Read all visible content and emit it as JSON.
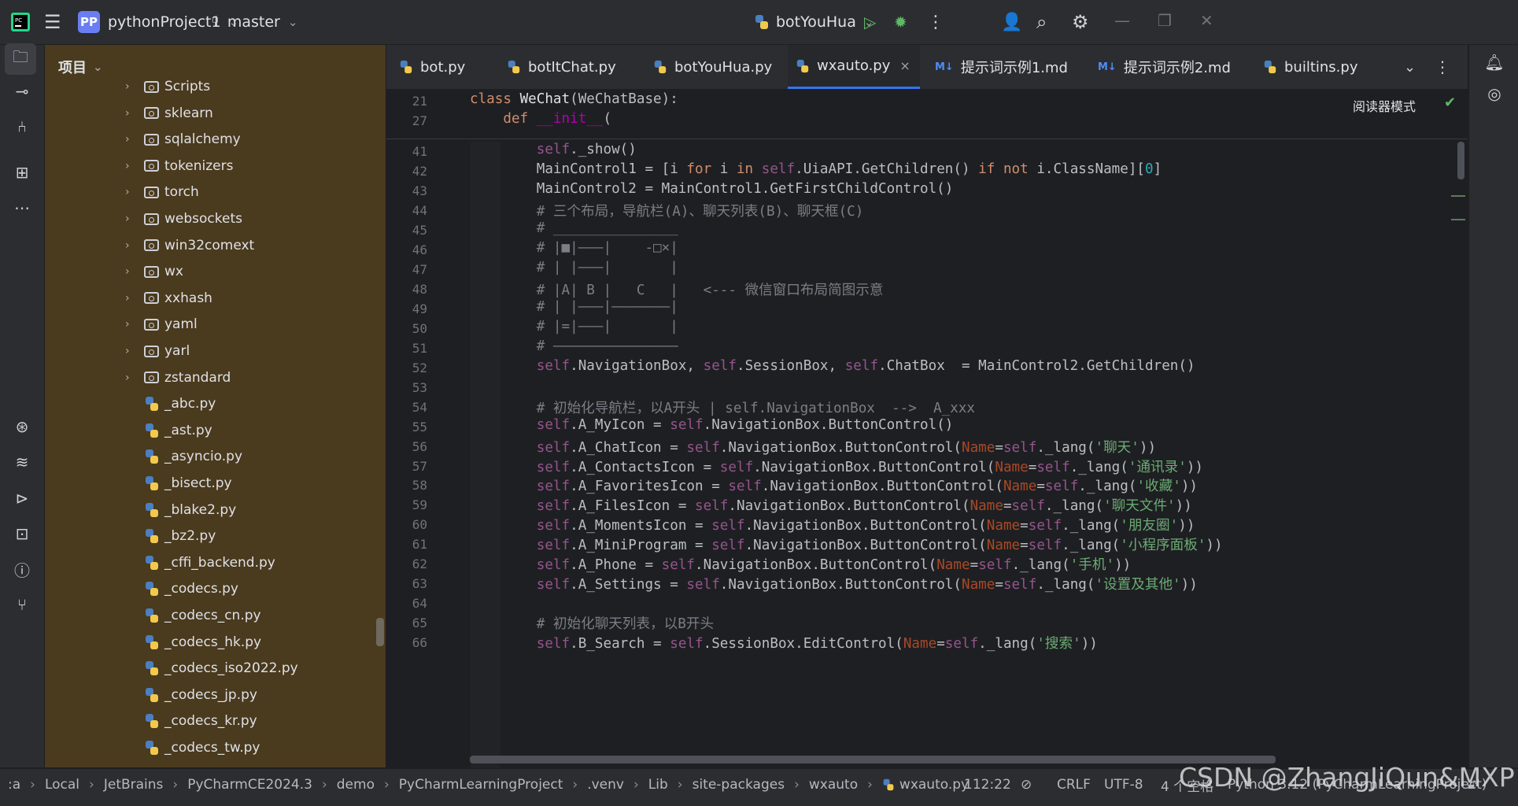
{
  "titlebar": {
    "project_badge": "PP",
    "project_name": "pythonProject1",
    "branch": "master",
    "run_config": "botYouHua"
  },
  "project_panel": {
    "title": "项目",
    "folders": [
      "Scripts",
      "sklearn",
      "sqlalchemy",
      "tokenizers",
      "torch",
      "websockets",
      "win32comext",
      "wx",
      "xxhash",
      "yaml",
      "yarl",
      "zstandard"
    ],
    "files": [
      "_abc.py",
      "_ast.py",
      "_asyncio.py",
      "_bisect.py",
      "_blake2.py",
      "_bz2.py",
      "_cffi_backend.py",
      "_codecs.py",
      "_codecs_cn.py",
      "_codecs_hk.py",
      "_codecs_iso2022.py",
      "_codecs_jp.py",
      "_codecs_kr.py",
      "_codecs_tw.py"
    ]
  },
  "tabs": [
    {
      "label": "bot.py",
      "type": "py"
    },
    {
      "label": "botItChat.py",
      "type": "py"
    },
    {
      "label": "botYouHua.py",
      "type": "py"
    },
    {
      "label": "wxauto.py",
      "type": "py",
      "active": true
    },
    {
      "label": "提示词示例1.md",
      "type": "md"
    },
    {
      "label": "提示词示例2.md",
      "type": "md"
    },
    {
      "label": "builtins.py",
      "type": "py"
    }
  ],
  "editor": {
    "reader_mode": "阅读器模式",
    "md_icon_text": "M↓",
    "sticky_lines": [
      {
        "num": "21",
        "html": "<span class='kw'>class</span> <span class='fn'>WeChat</span>(WeChatBase):"
      },
      {
        "num": "27",
        "html": "    <span class='kw'>def</span> <span class='dn'>__init__</span>("
      }
    ],
    "lines": [
      {
        "num": "41",
        "html": "        <span class='sf'>self</span>._show()"
      },
      {
        "num": "42",
        "html": "        MainControl1 = [i <span class='kw'>for</span> i <span class='kw'>in</span> <span class='sf'>self</span>.UiaAPI.GetChildren() <span class='kw'>if not</span> i.ClassName][<span class='nm'>0</span>]"
      },
      {
        "num": "43",
        "html": "        MainControl2 = MainControl1.GetFirstChildControl()"
      },
      {
        "num": "44",
        "html": "        <span class='cm'># 三个布局，导航栏(A)、聊天列表(B)、聊天框(C)</span>"
      },
      {
        "num": "45",
        "html": "        <span class='cm'># _______________</span>"
      },
      {
        "num": "46",
        "html": "        <span class='cm'># |■|———|    -□×|</span>"
      },
      {
        "num": "47",
        "html": "        <span class='cm'># | |———|       |</span>"
      },
      {
        "num": "48",
        "html": "        <span class='cm'># |A| B |   C   |   &lt;--- 微信窗口布局简图示意</span>"
      },
      {
        "num": "49",
        "html": "        <span class='cm'># | |———|———————|</span>"
      },
      {
        "num": "50",
        "html": "        <span class='cm'># |=|———|       |</span>"
      },
      {
        "num": "51",
        "html": "        <span class='cm'># ———————————————</span>"
      },
      {
        "num": "52",
        "html": "        <span class='sf'>self</span>.NavigationBox, <span class='sf'>self</span>.SessionBox, <span class='sf'>self</span>.ChatBox  = MainControl2.GetChildren()"
      },
      {
        "num": "53",
        "html": ""
      },
      {
        "num": "54",
        "html": "        <span class='cm'># 初始化导航栏，以A开头 | self.NavigationBox  --&gt;  A_xxx</span>"
      },
      {
        "num": "55",
        "html": "        <span class='sf'>self</span>.A_MyIcon = <span class='sf'>self</span>.NavigationBox.ButtonControl()"
      },
      {
        "num": "56",
        "html": "        <span class='sf'>self</span>.A_ChatIcon = <span class='sf'>self</span>.NavigationBox.ButtonControl(<span class='pr'>Name</span>=<span class='sf'>self</span>._lang(<span class='st'>'聊天'</span>))"
      },
      {
        "num": "57",
        "html": "        <span class='sf'>self</span>.A_ContactsIcon = <span class='sf'>self</span>.NavigationBox.ButtonControl(<span class='pr'>Name</span>=<span class='sf'>self</span>._lang(<span class='st'>'通讯录'</span>))"
      },
      {
        "num": "58",
        "html": "        <span class='sf'>self</span>.A_FavoritesIcon = <span class='sf'>self</span>.NavigationBox.ButtonControl(<span class='pr'>Name</span>=<span class='sf'>self</span>._lang(<span class='st'>'收藏'</span>))"
      },
      {
        "num": "59",
        "html": "        <span class='sf'>self</span>.A_FilesIcon = <span class='sf'>self</span>.NavigationBox.ButtonControl(<span class='pr'>Name</span>=<span class='sf'>self</span>._lang(<span class='st'>'聊天文件'</span>))"
      },
      {
        "num": "60",
        "html": "        <span class='sf'>self</span>.A_MomentsIcon = <span class='sf'>self</span>.NavigationBox.ButtonControl(<span class='pr'>Name</span>=<span class='sf'>self</span>._lang(<span class='st'>'朋友圈'</span>))"
      },
      {
        "num": "61",
        "html": "        <span class='sf'>self</span>.A_MiniProgram = <span class='sf'>self</span>.NavigationBox.ButtonControl(<span class='pr'>Name</span>=<span class='sf'>self</span>._lang(<span class='st'>'小程序面板'</span>))"
      },
      {
        "num": "62",
        "html": "        <span class='sf'>self</span>.A_Phone = <span class='sf'>self</span>.NavigationBox.ButtonControl(<span class='pr'>Name</span>=<span class='sf'>self</span>._lang(<span class='st'>'手机'</span>))"
      },
      {
        "num": "63",
        "html": "        <span class='sf'>self</span>.A_Settings = <span class='sf'>self</span>.NavigationBox.ButtonControl(<span class='pr'>Name</span>=<span class='sf'>self</span>._lang(<span class='st'>'设置及其他'</span>))"
      },
      {
        "num": "64",
        "html": ""
      },
      {
        "num": "65",
        "html": "        <span class='cm'># 初始化聊天列表，以B开头</span>"
      },
      {
        "num": "66",
        "html": "        <span class='sf'>self</span>.B_Search = <span class='sf'>self</span>.SessionBox.EditControl(<span class='pr'>Name</span>=<span class='sf'>self</span>._lang(<span class='st'>'搜索'</span>))"
      }
    ]
  },
  "statusbar": {
    "breadcrumbs": [
      ":a",
      "Local",
      "JetBrains",
      "PyCharmCE2024.3",
      "demo",
      "PyCharmLearningProject",
      ".venv",
      "Lib",
      "site-packages",
      "wxauto",
      "wxauto.py"
    ],
    "position": "112:22",
    "line_sep": "CRLF",
    "encoding": "UTF-8",
    "indent": "4 个空格",
    "interpreter": "Python 3.12 (PyCharmLearningProject)"
  },
  "watermark": "CSDN @ZhangJiQun&MXP",
  "colors": {
    "accent": "#3574f0",
    "project_bg": "#4a3a1e",
    "editor_bg": "#1e1f22"
  }
}
